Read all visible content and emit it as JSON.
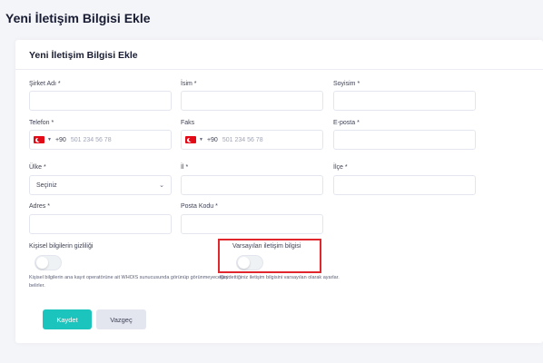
{
  "page_title": "Yeni İletişim Bilgisi Ekle",
  "card_title": "Yeni İletişim Bilgisi Ekle",
  "fields": {
    "company": {
      "label": "Şirket Adı *"
    },
    "name": {
      "label": "İsim *"
    },
    "surname": {
      "label": "Soyisim *"
    },
    "phone": {
      "label": "Telefon *",
      "dial_code": "+90",
      "placeholder": "501 234 56 78"
    },
    "fax": {
      "label": "Faks",
      "dial_code": "+90",
      "placeholder": "501 234 56 78"
    },
    "email": {
      "label": "E-posta *"
    },
    "country": {
      "label": "Ülke *",
      "value": "Seçiniz"
    },
    "province": {
      "label": "İl *"
    },
    "district": {
      "label": "İlçe *"
    },
    "address": {
      "label": "Adres *"
    },
    "postal_code": {
      "label": "Posta Kodu *"
    }
  },
  "privacy": {
    "label": "Kişisel bilgilerin gizliliği",
    "help": "Kişisel bilgilerin ana kayıt operatörüne ait WHOIS sunucusunda görünüp görünmeyeceğini belirler.",
    "enabled": false
  },
  "default_contact": {
    "label": "Varsayılan iletişim bilgisi",
    "help": "Kaydettiğiniz iletişim bilgisini varsayılan olarak ayarlar.",
    "enabled": false
  },
  "buttons": {
    "save": "Kaydet",
    "cancel": "Vazgeç"
  },
  "colors": {
    "primary": "#1bc5bd",
    "highlight": "#e0272d",
    "flag": "#e30a17"
  },
  "icons": {
    "country_flag": "turkey-flag-icon",
    "select_chevron": "chevron-down-icon"
  }
}
